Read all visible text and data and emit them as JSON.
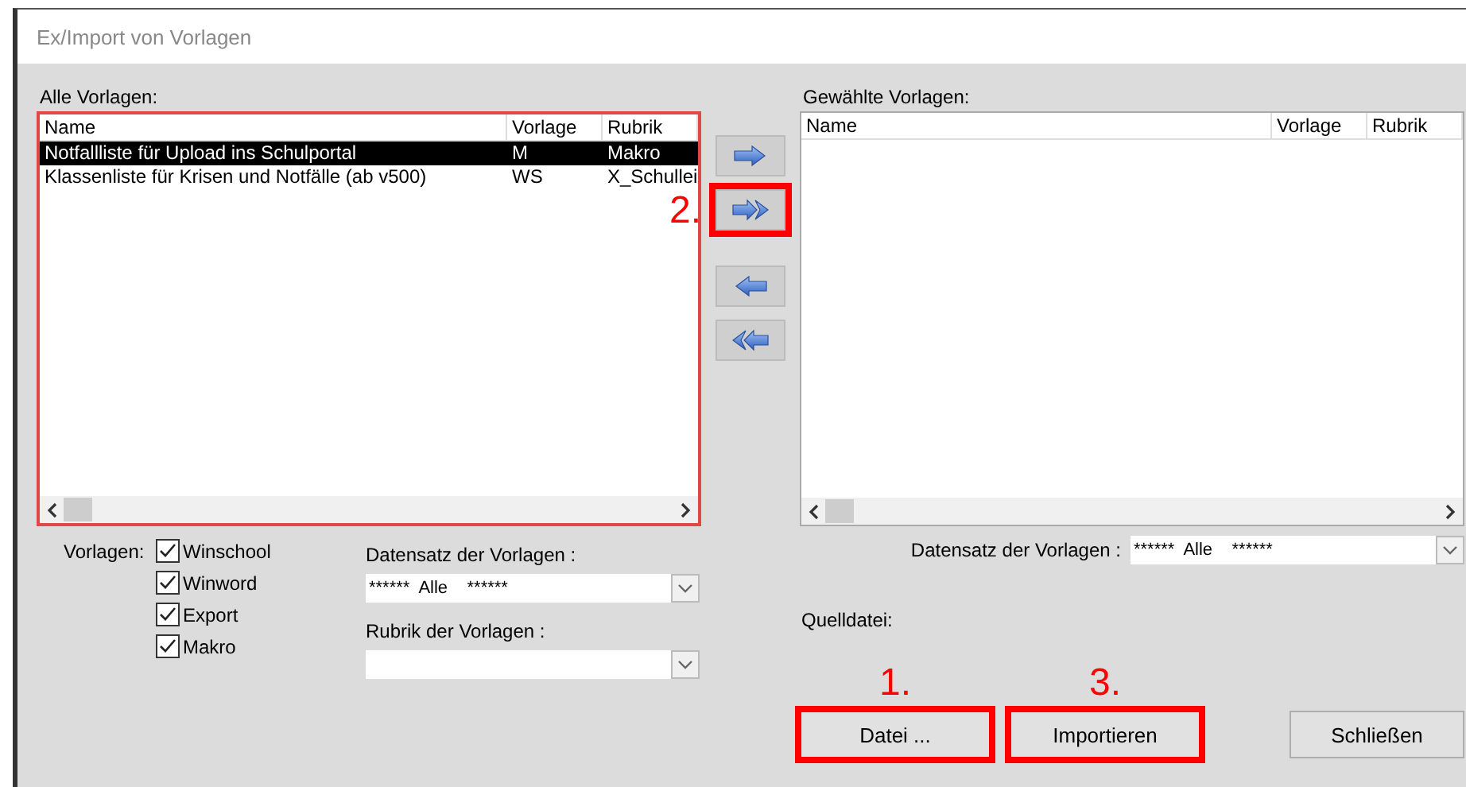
{
  "window": {
    "title": "Ex/Import von Vorlagen"
  },
  "all_templates": {
    "label": "Alle Vorlagen:",
    "highlighted": true,
    "columns": [
      "Name",
      "Vorlage",
      "Rubrik"
    ],
    "rows": [
      {
        "cells": [
          "Notfallliste für Upload ins Schulportal",
          "M",
          "Makro"
        ],
        "selected": true
      },
      {
        "cells": [
          "Klassenliste für Krisen und Notfälle (ab v500)",
          "WS",
          "X_Schullei"
        ],
        "selected": false
      }
    ]
  },
  "transfer_buttons": [
    {
      "kind": "single-right",
      "highlighted": false
    },
    {
      "kind": "all-right",
      "highlighted": true,
      "annotation": "2."
    },
    {
      "kind": "single-left",
      "highlighted": false
    },
    {
      "kind": "all-left",
      "highlighted": false
    }
  ],
  "selected_templates": {
    "label": "Gewählte Vorlagen:",
    "columns": [
      "Name",
      "Vorlage",
      "Rubrik"
    ]
  },
  "filters": {
    "label": "Vorlagen:",
    "checkboxes": [
      {
        "label": "Winschool",
        "checked": true
      },
      {
        "label": "Winword",
        "checked": true
      },
      {
        "label": "Export",
        "checked": true
      },
      {
        "label": "Makro",
        "checked": true
      }
    ],
    "dataset": {
      "label": "Datensatz der Vorlagen :",
      "value": "******  Alle    ******"
    },
    "category": {
      "label": "Rubrik der Vorlagen :"
    }
  },
  "right_dataset": {
    "label": "Datensatz der Vorlagen :",
    "value": "******  Alle    ******"
  },
  "source_file": {
    "label": "Quelldatei:"
  },
  "buttons": [
    {
      "label": "Datei ...",
      "highlighted": true,
      "annotation": "1."
    },
    {
      "label": "Importieren",
      "highlighted": true,
      "annotation": "3."
    },
    {
      "label": "Schließen",
      "highlighted": false
    }
  ]
}
